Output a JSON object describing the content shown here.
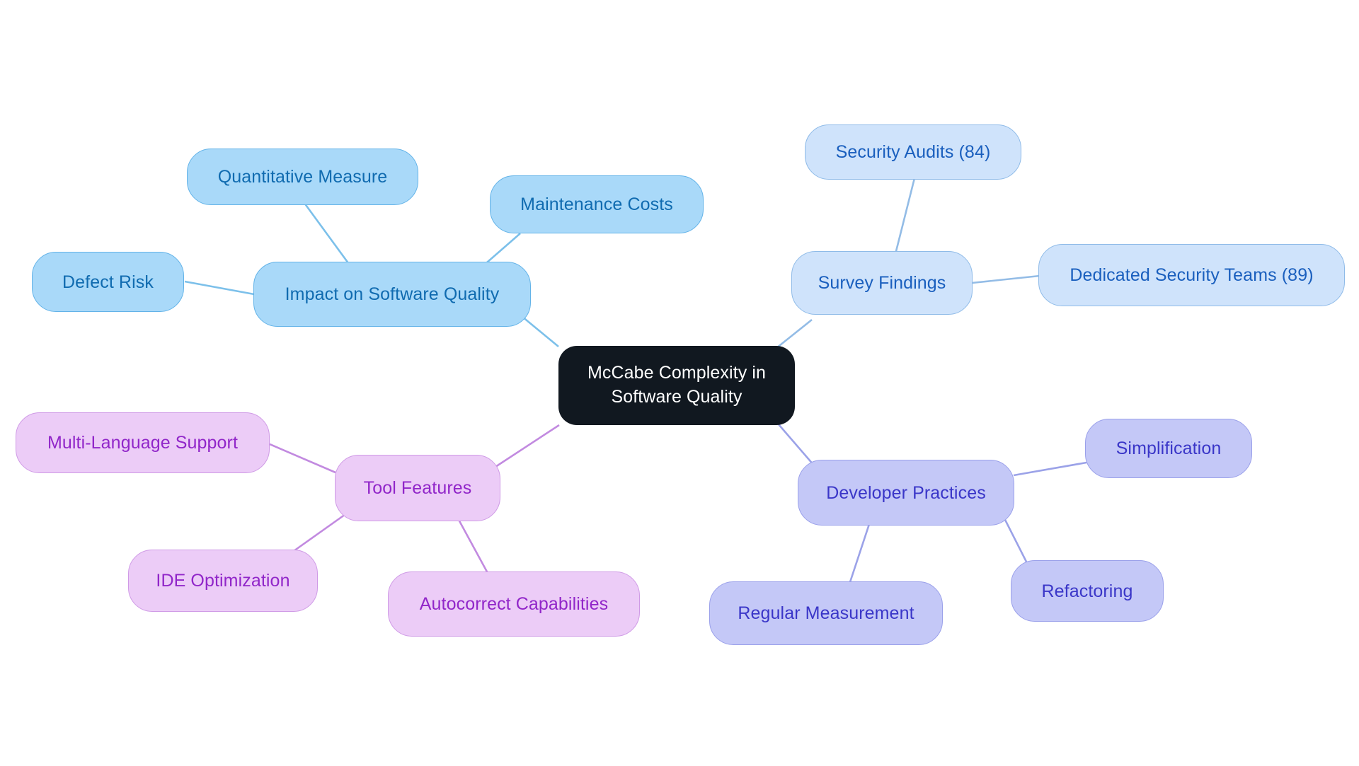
{
  "diagram": {
    "kind": "mindmap",
    "title": "McCabe Complexity in Software Quality",
    "background": "#ffffff"
  },
  "palette": {
    "root_fill": "#111820",
    "root_text": "#ffffff",
    "blue_mid_fill": "#a9d9f9",
    "blue_mid_border": "#63b3e8",
    "blue_mid_text": "#106bb0",
    "blue_light_fill": "#cfe3fb",
    "blue_light_border": "#8fbbe8",
    "blue_light_text": "#1a5fbe",
    "violet_fill": "#c4c8f7",
    "violet_border": "#9aa0ea",
    "violet_text": "#3a36c8",
    "orchid_fill": "#ecccf7",
    "orchid_border": "#cf9ae6",
    "orchid_text": "#9126c9",
    "edge_blue_mid": "#7cc0ea",
    "edge_blue_light": "#93bce6",
    "edge_violet": "#9ba2e8",
    "edge_orchid": "#c28ae0"
  },
  "nodes": {
    "root": {
      "label": "McCabe Complexity in\nSoftware Quality"
    },
    "impact": {
      "label": "Impact on Software Quality"
    },
    "quantitative_measure": {
      "label": "Quantitative Measure"
    },
    "maintenance_costs": {
      "label": "Maintenance Costs"
    },
    "defect_risk": {
      "label": "Defect Risk"
    },
    "survey_findings": {
      "label": "Survey Findings"
    },
    "security_audits": {
      "label": "Security Audits (84)"
    },
    "dedicated_security_teams": {
      "label": "Dedicated Security Teams (89)"
    },
    "developer_practices": {
      "label": "Developer Practices"
    },
    "simplification": {
      "label": "Simplification"
    },
    "refactoring": {
      "label": "Refactoring"
    },
    "regular_measurement": {
      "label": "Regular Measurement"
    },
    "tool_features": {
      "label": "Tool Features"
    },
    "multi_language_support": {
      "label": "Multi-Language Support"
    },
    "ide_optimization": {
      "label": "IDE Optimization"
    },
    "autocorrect_capabilities": {
      "label": "Autocorrect Capabilities"
    }
  },
  "chart_data": {
    "type": "diagram",
    "title": "McCabe Complexity in Software Quality",
    "root": "McCabe Complexity in Software Quality",
    "branches": [
      {
        "name": "Impact on Software Quality",
        "color_group": "blue-mid",
        "children": [
          "Quantitative Measure",
          "Maintenance Costs",
          "Defect Risk"
        ]
      },
      {
        "name": "Survey Findings",
        "color_group": "blue-light",
        "children": [
          "Security Audits (84)",
          "Dedicated Security Teams (89)"
        ]
      },
      {
        "name": "Developer Practices",
        "color_group": "violet",
        "children": [
          "Simplification",
          "Refactoring",
          "Regular Measurement"
        ]
      },
      {
        "name": "Tool Features",
        "color_group": "orchid",
        "children": [
          "Multi-Language Support",
          "IDE Optimization",
          "Autocorrect Capabilities"
        ]
      }
    ],
    "annotations": [
      {
        "text": "Security Audits (84)",
        "value": 84
      },
      {
        "text": "Dedicated Security Teams (89)",
        "value": 89
      }
    ]
  }
}
